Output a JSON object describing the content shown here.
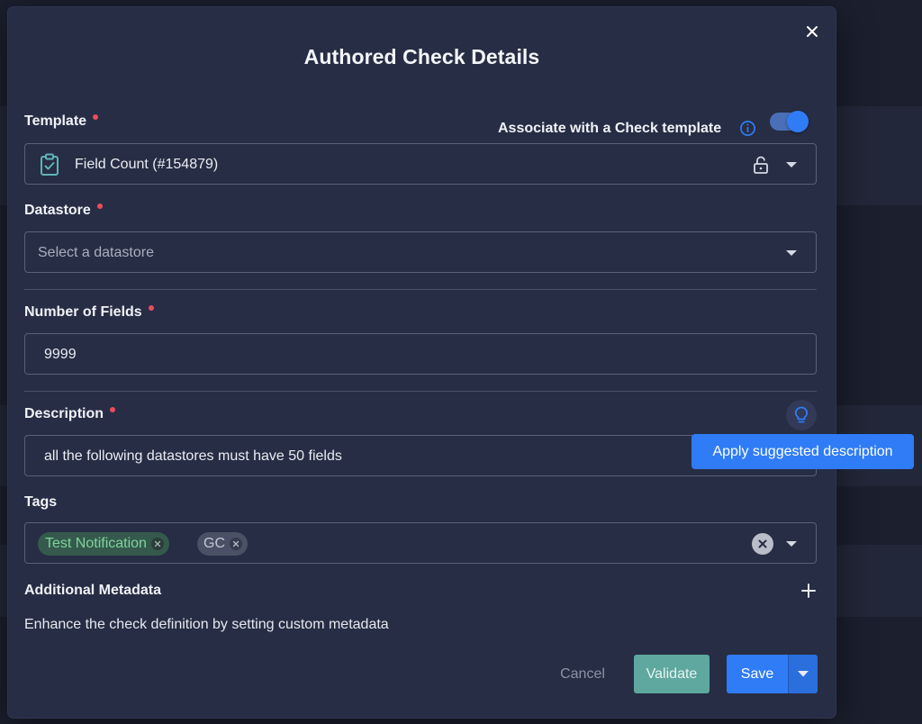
{
  "modal": {
    "title": "Authored Check Details",
    "close_label": "close"
  },
  "template": {
    "label": "Template",
    "associate_label": "Associate with a Check template",
    "associate_enabled": true,
    "value": "Field Count (#154879)"
  },
  "datastore": {
    "label": "Datastore",
    "placeholder": "Select a datastore"
  },
  "number_of_fields": {
    "label": "Number of Fields",
    "value": "9999"
  },
  "description": {
    "label": "Description",
    "value": "all the following datastores must have 50 fields",
    "tooltip": "Apply suggested description"
  },
  "tags": {
    "label": "Tags",
    "items": [
      {
        "label": "Test Notification",
        "color": "#5fb37e"
      },
      {
        "label": "GC",
        "color": "#a9aec0"
      }
    ]
  },
  "metadata": {
    "label": "Additional Metadata",
    "description": "Enhance the check definition by setting custom metadata"
  },
  "actions": {
    "cancel": "Cancel",
    "validate": "Validate",
    "save": "Save"
  },
  "colors": {
    "primary": "#2f7cf6",
    "validate": "#5fa89f",
    "required": "#ef4b5d",
    "modal_bg": "#272d44"
  }
}
